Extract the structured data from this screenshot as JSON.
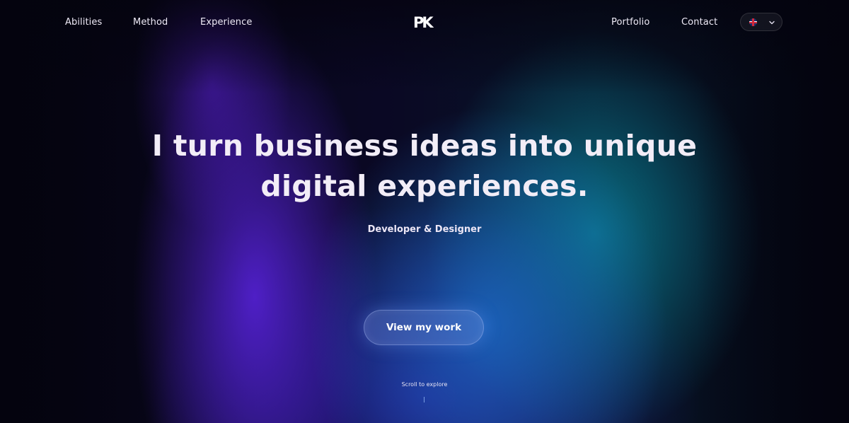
{
  "nav": {
    "left_links": [
      "Abilities",
      "Method",
      "Experience"
    ],
    "logo": "PK",
    "right_links": [
      "Portfolio",
      "Contact"
    ],
    "language": {
      "flag_icon": "uk-flag-icon",
      "dropdown_icon": "chevron-down-icon"
    }
  },
  "hero": {
    "headline_line1": "I turn business ideas into unique",
    "headline_line2": "digital experiences.",
    "subtitle": "Developer & Designer",
    "cta_label": "View my work",
    "scroll_hint": "Scroll to explore"
  },
  "colors": {
    "background": "#07061a",
    "accent_purple": "#5220ce",
    "accent_teal": "#0a8096",
    "accent_blue": "#1c68c4",
    "text": "#f2edf7"
  }
}
